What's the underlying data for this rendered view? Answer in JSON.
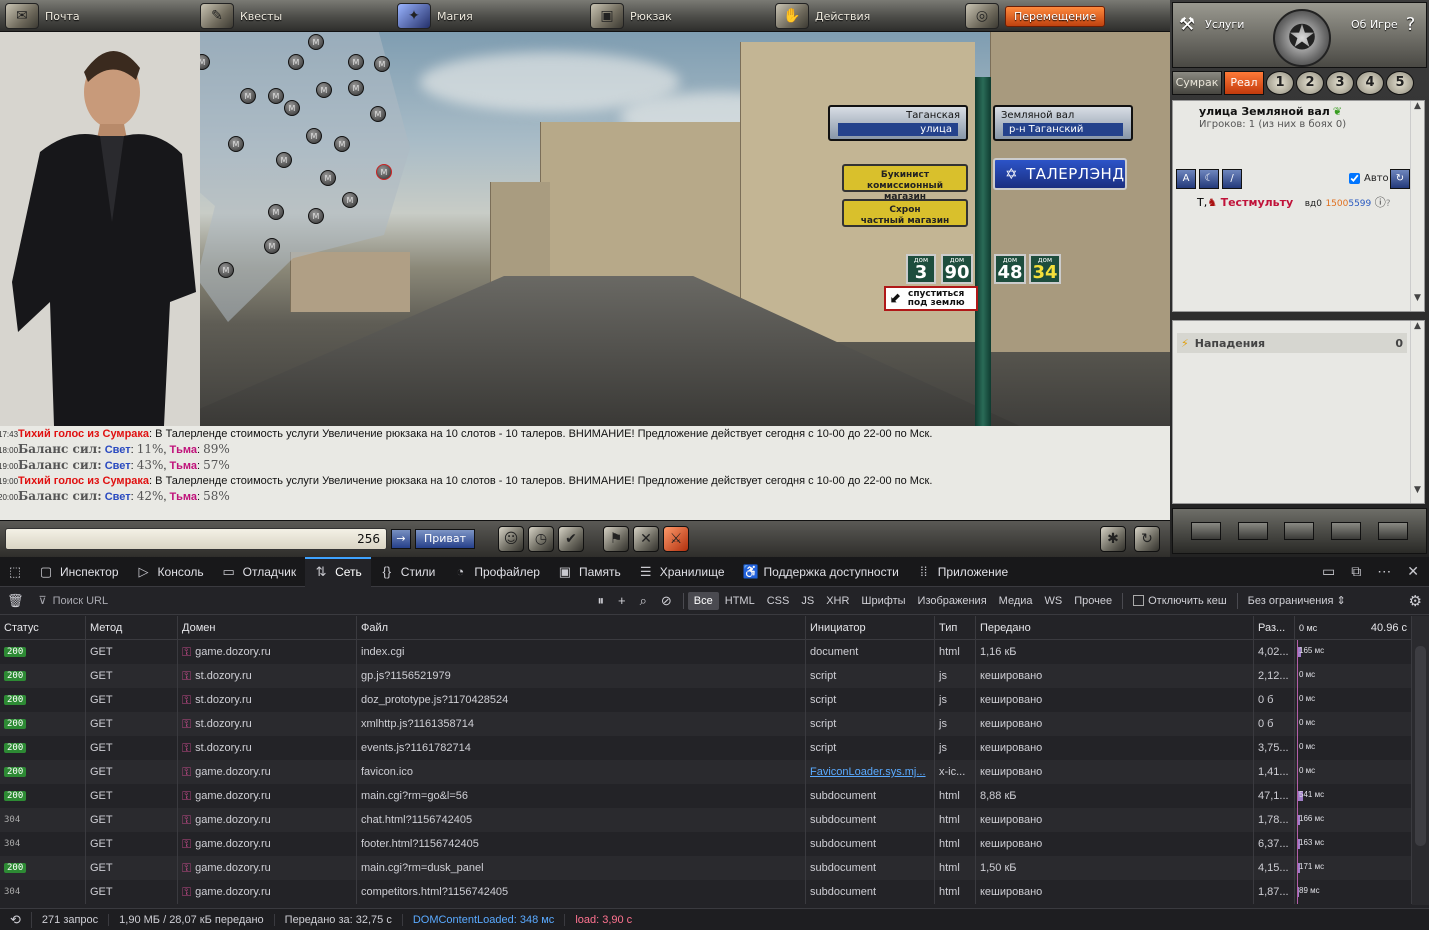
{
  "game": {
    "nav": [
      {
        "label": "Почта",
        "icon": "mail-icon"
      },
      {
        "label": "Квесты",
        "icon": "quest-scroll-icon"
      },
      {
        "label": "Магия",
        "icon": "magic-icon"
      },
      {
        "label": "Рюкзак",
        "icon": "backpack-icon"
      },
      {
        "label": "Действия",
        "icon": "actions-icon"
      },
      {
        "label": "Перемещение",
        "icon": "compass-icon"
      }
    ],
    "signs": {
      "street_left": "Таганская",
      "street_left_sub": "улица",
      "street_right": "Земляной вал",
      "street_right_sub": "р-н Таганский",
      "shop1": "Букинист\nкомиссионный магазин",
      "shop2": "Схрон\nчастный магазин",
      "brand": "ТАЛЕРЛЭНД",
      "house_label": "дом",
      "houses": [
        "3",
        "90",
        "48",
        "34"
      ],
      "underground": "спуститься\nпод землю"
    },
    "metro_marker": "M",
    "chat": [
      {
        "time": "17:43",
        "speaker": "Тихий голос из Сумрака",
        "text": "В Талерленде стоимость услуги Увеличение рюкзака на 10 слотов - 10 талеров. ВНИМАНИЕ! Предложение действует сегодня с 10-00 до 22-00 по Мск."
      },
      {
        "time": "18:00",
        "balance_label": "Баланс сил:",
        "light_label": "Свет",
        "light": "11%",
        "dark_label": "Тьма",
        "dark": "89%"
      },
      {
        "time": "19:00",
        "balance_label": "Баланс сил:",
        "light_label": "Свет",
        "light": "43%",
        "dark_label": "Тьма",
        "dark": "57%"
      },
      {
        "time": "19:00",
        "speaker": "Тихий голос из Сумрака",
        "text": "В Талерленде стоимость услуги Увеличение рюкзака на 10 слотов - 10 талеров. ВНИМАНИЕ! Предложение действует сегодня с 10-00 до 22-00 по Мск."
      },
      {
        "time": "20:00",
        "balance_label": "Баланс сил:",
        "light_label": "Свет",
        "light": "42%",
        "dark_label": "Тьма",
        "dark": "58%"
      }
    ],
    "input": {
      "counter": "256",
      "send": "→",
      "private": "Приват"
    },
    "right": {
      "services": "Услуги",
      "about": "Об Игре",
      "tabs": [
        "Сумрак",
        "Реал",
        "1",
        "2",
        "3",
        "4",
        "5"
      ],
      "location_title": "улица Земляной вал",
      "players_line": "Игроков: 1 (из них в боях 0)",
      "auto_label": "Авто",
      "player_prefix": "Т,",
      "player_name": "Тестмульту",
      "player_tag": "вд0",
      "player_id1": "1500",
      "player_id2": "5599",
      "attacks_label": "Нападения",
      "attacks_count": "0"
    }
  },
  "devtools": {
    "tabs": [
      {
        "label": "Инспектор",
        "icon": "inspector-icon"
      },
      {
        "label": "Консоль",
        "icon": "console-icon"
      },
      {
        "label": "Отладчик",
        "icon": "debugger-icon"
      },
      {
        "label": "Сеть",
        "icon": "network-icon"
      },
      {
        "label": "Стили",
        "icon": "styles-icon"
      },
      {
        "label": "Профайлер",
        "icon": "profiler-icon"
      },
      {
        "label": "Память",
        "icon": "memory-icon"
      },
      {
        "label": "Хранилище",
        "icon": "storage-icon"
      },
      {
        "label": "Поддержка доступности",
        "icon": "accessibility-icon"
      },
      {
        "label": "Приложение",
        "icon": "application-icon"
      }
    ],
    "filter": {
      "placeholder": "Поиск URL",
      "types": [
        "Все",
        "HTML",
        "CSS",
        "JS",
        "XHR",
        "Шрифты",
        "Изображения",
        "Медиа",
        "WS",
        "Прочее"
      ],
      "disable_cache": "Отключить кеш",
      "throttle": "Без ограничения ⇕"
    },
    "columns": [
      "Статус",
      "Метод",
      "Домен",
      "Файл",
      "Инициатор",
      "Тип",
      "Передано",
      "Раз...",
      "0 мс",
      "40.96 с"
    ],
    "rows": [
      {
        "status": "200",
        "method": "GET",
        "domain": "game.dozory.ru",
        "file": "index.cgi",
        "initiator": "document",
        "type": "html",
        "transferred": "1,16 кБ",
        "size": "4,02...",
        "time": "165 мс",
        "wf_w": 4
      },
      {
        "status": "200",
        "method": "GET",
        "domain": "st.dozory.ru",
        "file": "gp.js?1156521979",
        "initiator": "script",
        "type": "js",
        "transferred": "кешировано",
        "size": "2,12...",
        "time": "0 мс",
        "wf_w": 0
      },
      {
        "status": "200",
        "method": "GET",
        "domain": "st.dozory.ru",
        "file": "doz_prototype.js?1170428524",
        "initiator": "script",
        "type": "js",
        "transferred": "кешировано",
        "size": "0 б",
        "time": "0 мс",
        "wf_w": 0
      },
      {
        "status": "200",
        "method": "GET",
        "domain": "st.dozory.ru",
        "file": "xmlhttp.js?1161358714",
        "initiator": "script",
        "type": "js",
        "transferred": "кешировано",
        "size": "0 б",
        "time": "0 мс",
        "wf_w": 0
      },
      {
        "status": "200",
        "method": "GET",
        "domain": "st.dozory.ru",
        "file": "events.js?1161782714",
        "initiator": "script",
        "type": "js",
        "transferred": "кешировано",
        "size": "3,75...",
        "time": "0 мс",
        "wf_w": 0
      },
      {
        "status": "200",
        "method": "GET",
        "domain": "game.dozory.ru",
        "file": "favicon.ico",
        "initiator": "FaviconLoader.sys.mj...",
        "initiator_link": true,
        "type": "x-ic...",
        "transferred": "кешировано",
        "size": "1,41...",
        "time": "0 мс",
        "wf_w": 0
      },
      {
        "status": "200",
        "method": "GET",
        "domain": "game.dozory.ru",
        "file": "main.cgi?rm=go&l=56",
        "initiator": "subdocument",
        "type": "html",
        "transferred": "8,88 кБ",
        "size": "47,1...",
        "time": "541 мс",
        "wf_w": 6
      },
      {
        "status": "304",
        "method": "GET",
        "domain": "game.dozory.ru",
        "file": "chat.html?1156742405",
        "initiator": "subdocument",
        "type": "html",
        "transferred": "кешировано",
        "size": "1,78...",
        "time": "166 мс",
        "wf_w": 3
      },
      {
        "status": "304",
        "method": "GET",
        "domain": "game.dozory.ru",
        "file": "footer.html?1156742405",
        "initiator": "subdocument",
        "type": "html",
        "transferred": "кешировано",
        "size": "6,37...",
        "time": "163 мс",
        "wf_w": 3
      },
      {
        "status": "200",
        "method": "GET",
        "domain": "game.dozory.ru",
        "file": "main.cgi?rm=dusk_panel",
        "initiator": "subdocument",
        "type": "html",
        "transferred": "1,50 кБ",
        "size": "4,15...",
        "time": "171 мс",
        "wf_w": 3
      },
      {
        "status": "304",
        "method": "GET",
        "domain": "game.dozory.ru",
        "file": "competitors.html?1156742405",
        "initiator": "subdocument",
        "type": "html",
        "transferred": "кешировано",
        "size": "1,87...",
        "time": "89 мс",
        "wf_w": 2
      }
    ],
    "statusbar": {
      "requests": "271 запрос",
      "transferred": "1,90 МБ / 28,07 кБ передано",
      "finish": "Передано за: 32,75 с",
      "dcl": "DOMContentLoaded: 348 мс",
      "load": "load: 3,90 с"
    }
  }
}
